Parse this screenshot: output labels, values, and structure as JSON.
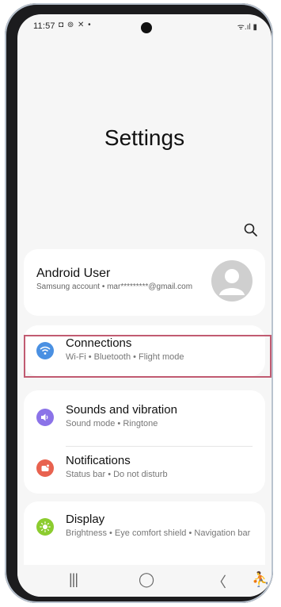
{
  "status_bar": {
    "time": "11:57",
    "left_icons": "◘ ⊚ ✕ •",
    "right_icons": "ᯤ.ıl ▮"
  },
  "page_title": "Settings",
  "account": {
    "name": "Android User",
    "subtitle": "Samsung account  •  mar*********@gmail.com"
  },
  "items": {
    "connections": {
      "label": "Connections",
      "sub": "Wi-Fi  •  Bluetooth  •  Flight mode",
      "icon": "wifi-icon",
      "color": "#4a90e2"
    },
    "sounds": {
      "label": "Sounds and vibration",
      "sub": "Sound mode  •  Ringtone",
      "icon": "speaker-icon",
      "color": "#8b73e8"
    },
    "notifications": {
      "label": "Notifications",
      "sub": "Status bar  •  Do not disturb",
      "icon": "notification-icon",
      "color": "#e8624f"
    },
    "display": {
      "label": "Display",
      "sub": "Brightness  •  Eye comfort shield  •  Navigation bar",
      "icon": "brightness-icon",
      "color": "#8ccc2f"
    }
  },
  "nav": {
    "recents": "|||",
    "home": "◯",
    "back": "〈",
    "accessibility": "⛹"
  },
  "colors": {
    "highlight_border": "#c15b71",
    "background": "#f6f6f6"
  }
}
